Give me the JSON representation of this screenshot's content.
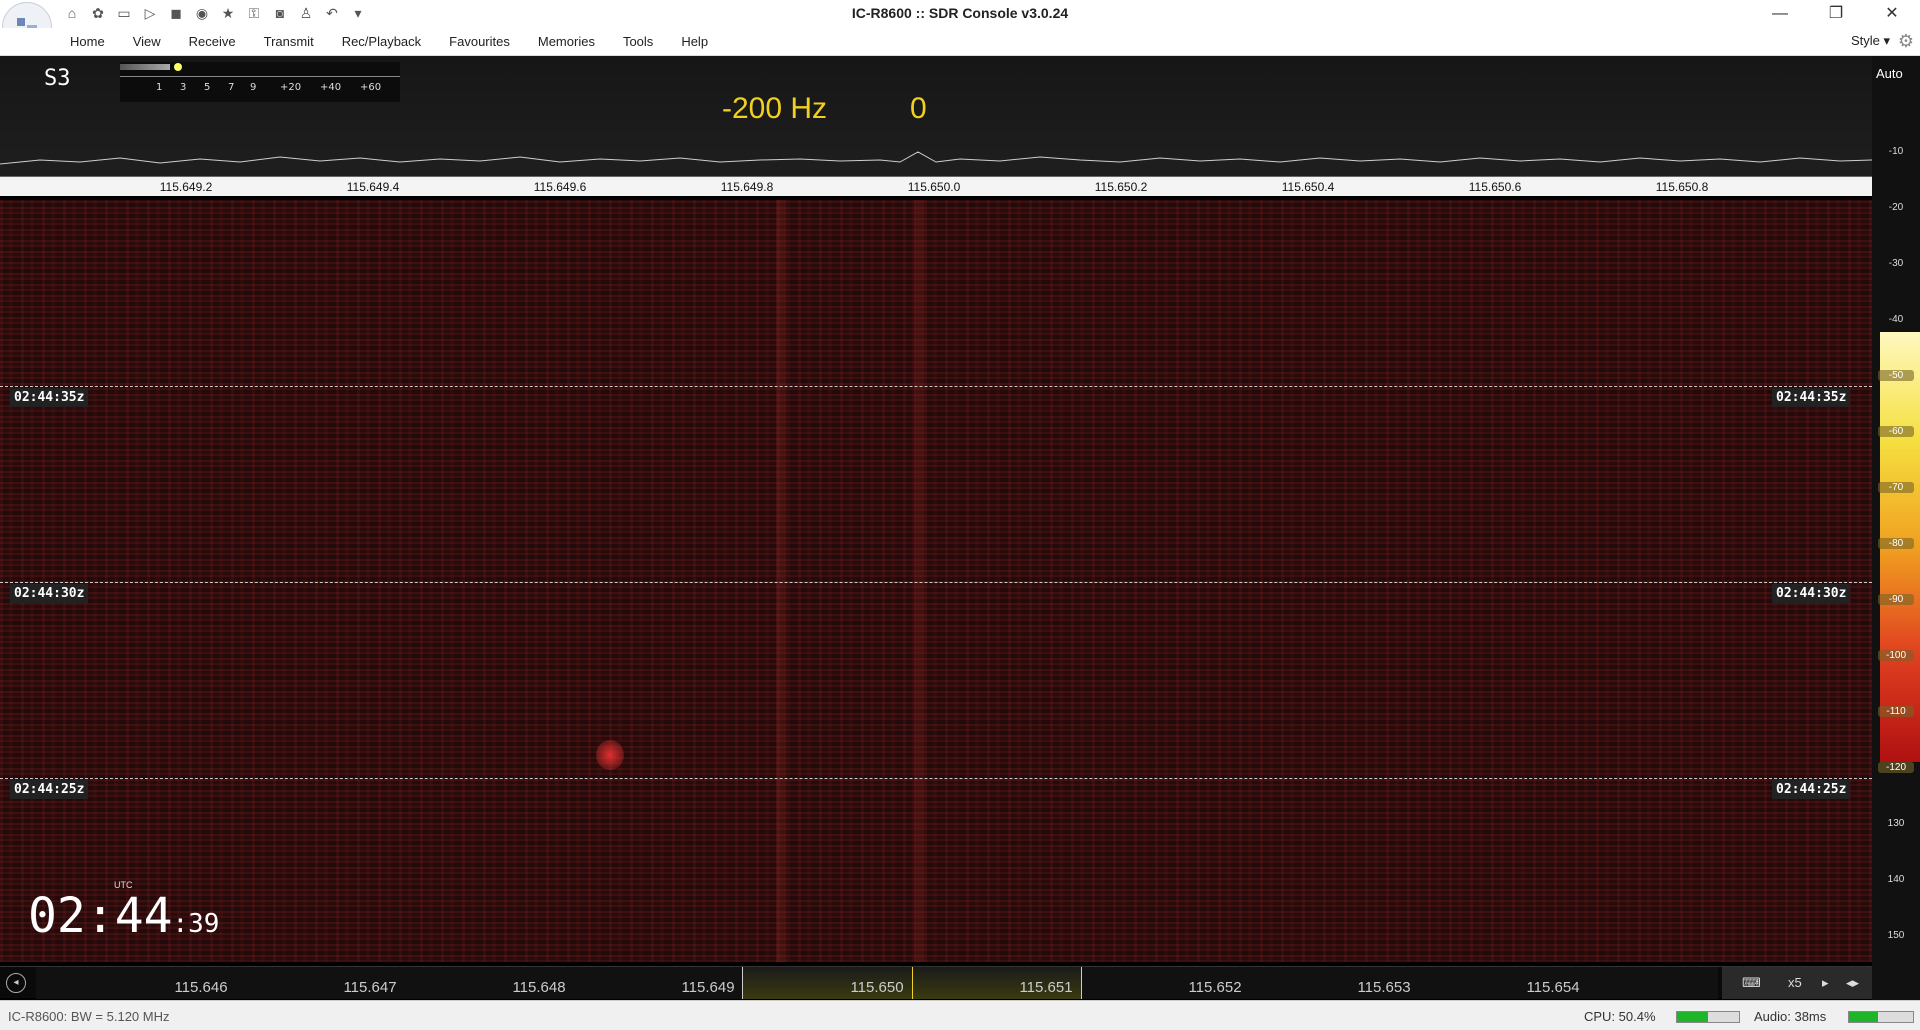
{
  "window": {
    "title": "IC-R8600 :: SDR Console v3.0.24",
    "min": "—",
    "max": "❐",
    "close": "✕"
  },
  "menu": [
    "Home",
    "View",
    "Receive",
    "Transmit",
    "Rec/Playback",
    "Favourites",
    "Memories",
    "Tools",
    "Help"
  ],
  "style_label": "Style",
  "spectrum": {
    "smeter_label": "S3",
    "smeter_scale": [
      "1",
      "3",
      "5",
      "7",
      "9",
      "+20",
      "+40",
      "+60"
    ],
    "offset": "-200 Hz",
    "offset_value": "0",
    "freq_labels": [
      "115.649.2",
      "115.649.4",
      "115.649.6",
      "115.649.8",
      "115.650.0",
      "115.650.2",
      "115.650.4",
      "115.650.6",
      "115.650.8"
    ]
  },
  "waterfall": {
    "timestamps": [
      "02:44:35z",
      "02:44:30z",
      "02:44:25z"
    ],
    "clock_utc_label": "UTC",
    "clock_time": "02:44",
    "clock_seconds": ":39"
  },
  "side_scale": {
    "auto_label": "Auto",
    "levels": [
      "-10",
      "-20",
      "-30",
      "-40",
      "-50",
      "-60",
      "-70",
      "-80",
      "-90",
      "-100",
      "-110",
      "-120",
      "130",
      "140",
      "150"
    ]
  },
  "bottom_axis": {
    "labels": [
      "115.646",
      "115.647",
      "115.648",
      "115.649",
      "115.650",
      "115.651",
      "115.652",
      "115.653",
      "115.654"
    ],
    "zoom": "x5"
  },
  "status": {
    "left": "IC-R8600: BW = 5.120 MHz",
    "cpu_label": "CPU: 50.4%",
    "cpu_fraction": 0.504,
    "audio_label": "Audio: 38ms"
  },
  "colors": {
    "offset_text": "#f0d020",
    "waterfall_base": "#2a0c0c",
    "meter_fill": "#1fb52a"
  }
}
